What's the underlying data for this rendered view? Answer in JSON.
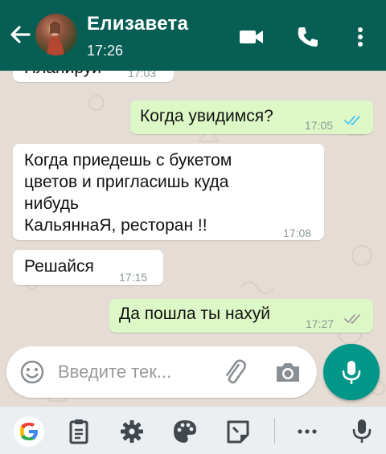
{
  "header": {
    "contact_name": "Елизавета",
    "status_time": "17:26",
    "icons": [
      "back-arrow-icon",
      "avatar",
      "video-call-icon",
      "phone-icon",
      "more-vert-icon"
    ]
  },
  "messages": [
    {
      "direction": "in",
      "text": "Планируй",
      "time": "17:03",
      "partial": true
    },
    {
      "direction": "out",
      "text": "Когда увидимся?",
      "time": "17:05",
      "status": "read"
    },
    {
      "direction": "in",
      "text": "Когда приедешь с букетом\nцветов и пригласишь куда\nнибудь\nКальяннаЯ, ресторан !!",
      "time": "17:08"
    },
    {
      "direction": "in",
      "text": "Решайся",
      "time": "17:15"
    },
    {
      "direction": "out",
      "text": "Да пошла ты нахуй",
      "time": "17:27",
      "status": "delivered"
    }
  ],
  "colors": {
    "header_bg": "#075e54",
    "chat_bg": "#e5ddd5",
    "incoming_bubble": "#ffffff",
    "outgoing_bubble": "#dcf8c6",
    "read_ticks": "#4fc3f7",
    "delivered_ticks": "#9e9e9e",
    "mic_button": "#009688"
  },
  "composer": {
    "placeholder": "Введите тек...",
    "icons": [
      "emoji-icon",
      "attach-icon",
      "camera-icon",
      "mic-icon"
    ]
  },
  "keyboard_toolbar": {
    "icons": [
      "google-icon",
      "clipboard-icon",
      "settings-icon",
      "palette-icon",
      "sticker-icon",
      "more-icon",
      "mic-icon"
    ]
  }
}
